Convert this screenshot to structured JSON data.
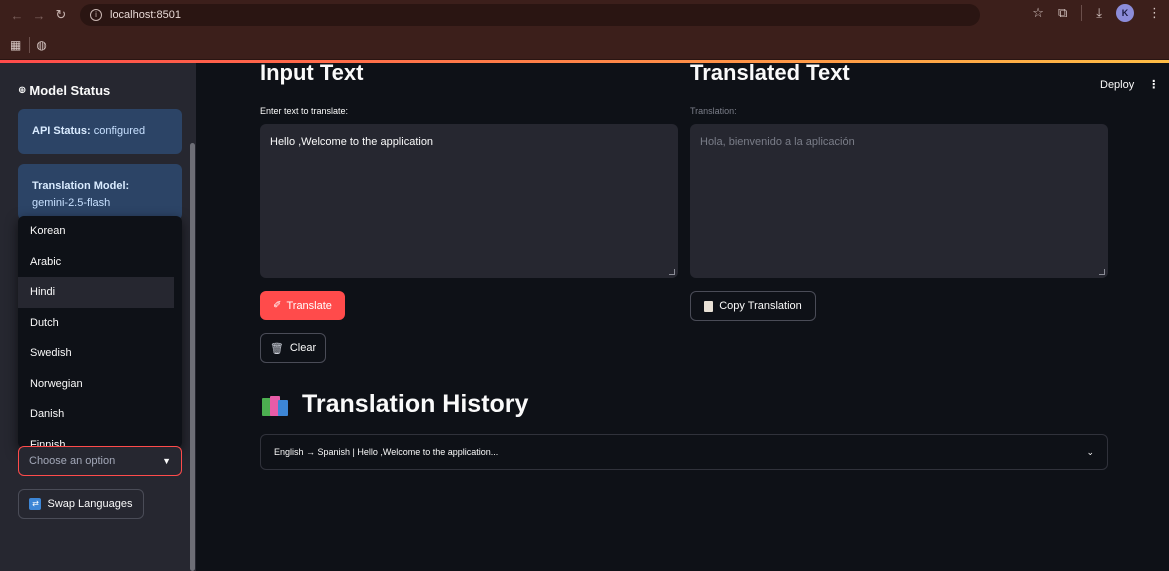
{
  "browser": {
    "url": "localhost:8501",
    "avatar_letter": "K"
  },
  "sidebar": {
    "title": "Model Status",
    "api_status_label": "API Status:",
    "api_status_value": "configured",
    "model_label": "Translation Model:",
    "model_value": "gemini-2.5-flash",
    "dropdown_options": [
      "Korean",
      "Arabic",
      "Hindi",
      "Dutch",
      "Swedish",
      "Norwegian",
      "Danish",
      "Finnish"
    ],
    "highlighted_option": "Hindi",
    "select_placeholder": "Choose an option",
    "swap_label": "Swap Languages"
  },
  "main": {
    "deploy_label": "Deploy",
    "input_heading": "Input Text",
    "input_label": "Enter text to translate:",
    "input_value": "Hello ,Welcome to the application",
    "translated_heading": "Translated Text",
    "translation_label": "Translation:",
    "translation_value": "Hola, bienvenido a la aplicación",
    "translate_button": "Translate",
    "copy_button": "Copy Translation",
    "clear_button": "Clear",
    "history_title": "Translation History",
    "history_entry": "English → Spanish | Hello ,Welcome to the application..."
  },
  "colors": {
    "accent": "#ff4b4b",
    "info_bg": "#2c4466",
    "sidebar_bg": "#262730",
    "app_bg": "#0e1117"
  }
}
